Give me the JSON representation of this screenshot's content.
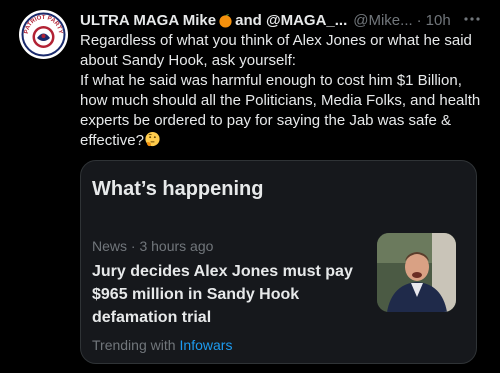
{
  "tweet": {
    "display_name": "ULTRA MAGA Mike",
    "display_name_suffix": "and @MAGA_...",
    "handle": "@Mike...",
    "separator": "·",
    "time": "10h",
    "avatar_text": "PATRIOT PARTY",
    "lines": [
      "Regardless of what you think of Alex Jones or what he said",
      "about Sandy Hook, ask yourself:",
      "If what he said was harmful enough to cost him $1 Billion,",
      "how much should all the Politicians, Media Folks, and health",
      "experts be ordered to pay for saying the Jab was safe &",
      "effective?"
    ],
    "emoji_after": "thinking-face",
    "accent_color": "#1d9bf0"
  },
  "card": {
    "title": "What’s happening",
    "source": "News",
    "separator": "·",
    "age": "3 hours ago",
    "headline": "Jury decides Alex Jones must pay $965 million in Sandy Hook defamation trial",
    "trending_label": "Trending with",
    "trending_link": "Infowars"
  }
}
